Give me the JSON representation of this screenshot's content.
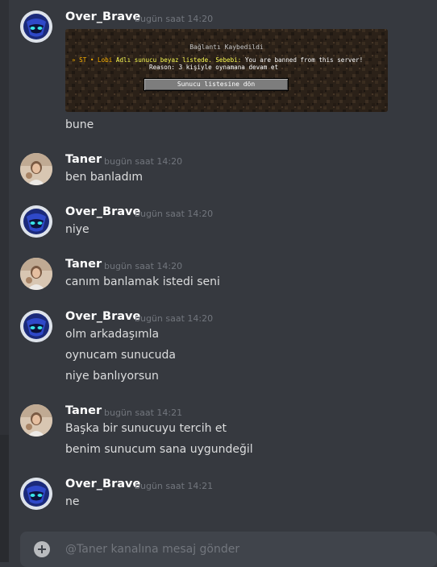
{
  "composer": {
    "placeholder": "@Taner kanalına mesaj gönder"
  },
  "messages": [
    {
      "author": "Over_Brave",
      "time": "bugün saat 14:20",
      "embed": {
        "title": "Bağlantı Kaybedildi",
        "line1_prefix": "» ST • Lobi",
        "line1_highlight": "Adlı sunucu beyaz listede. Sebebi:",
        "line1_rest": "You are banned from this server!",
        "line2": "Reason: 3 kişiyle oynamana devam et",
        "button": "Sunucu listesine dön"
      },
      "lines": [
        "bune"
      ]
    },
    {
      "author": "Taner",
      "time": "bugün saat 14:20",
      "lines": [
        "ben banladım"
      ]
    },
    {
      "author": "Over_Brave",
      "time": "bugün saat 14:20",
      "lines": [
        "niye"
      ]
    },
    {
      "author": "Taner",
      "time": "bugün saat 14:20",
      "lines": [
        "canım banlamak istedi seni"
      ]
    },
    {
      "author": "Over_Brave",
      "time": "bugün saat 14:20",
      "lines": [
        "olm arkadaşımla",
        "oynucam sunucuda",
        "niye banlıyorsun"
      ]
    },
    {
      "author": "Taner",
      "time": "bugün saat 14:21",
      "lines": [
        "Başka bir sunucuyu tercih et",
        "benim sunucum sana uygundeğil"
      ]
    },
    {
      "author": "Over_Brave",
      "time": "bugün saat 14:21",
      "lines": [
        "ne"
      ]
    }
  ]
}
